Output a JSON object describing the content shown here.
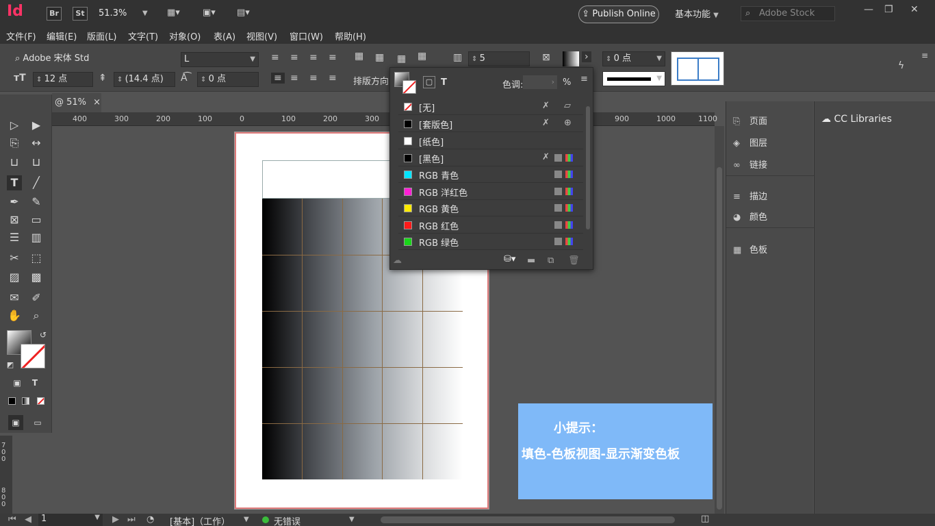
{
  "titlebar": {
    "app_logo": "Id",
    "bridge_label": "Br",
    "stock_label": "St",
    "zoom": "51.3%",
    "publish_label": "Publish Online",
    "workspace": "基本功能",
    "stock_placeholder": "Adobe Stock",
    "win_minimize": "—",
    "win_restore": "❐",
    "win_close": "✕"
  },
  "menu": [
    "文件(F)",
    "编辑(E)",
    "版面(L)",
    "文字(T)",
    "对象(O)",
    "表(A)",
    "视图(V)",
    "窗口(W)",
    "帮助(H)"
  ],
  "control": {
    "font_family": "Adobe 宋体 Std",
    "font_style": "L",
    "font_size": "12 点",
    "leading": "(14.4 点)",
    "tracking": "0 点",
    "columns": "5",
    "stroke_weight": "0 点",
    "direction_label": "排版方向"
  },
  "doc_tab": {
    "label": "@ 51%",
    "close": "×"
  },
  "ruler_ticks": [
    "400",
    "300",
    "200",
    "100",
    "0",
    "100",
    "200",
    "300",
    "900",
    "1000",
    "1100"
  ],
  "vruler_ticks": [
    "700",
    "800"
  ],
  "swatches": {
    "tint_label": "色调:",
    "tint_unit": "%",
    "items": [
      {
        "name": "[无]",
        "color": "#ffffff"
      },
      {
        "name": "[套版色]",
        "color": "#000000"
      },
      {
        "name": "[纸色]",
        "color": "#ffffff"
      },
      {
        "name": "[黑色]",
        "color": "#000000"
      },
      {
        "name": "RGB 青色",
        "color": "#00e5ff"
      },
      {
        "name": "RGB 洋红色",
        "color": "#ff1fd5"
      },
      {
        "name": "RGB 黄色",
        "color": "#ffea00"
      },
      {
        "name": "RGB 红色",
        "color": "#ff1a1a"
      },
      {
        "name": "RGB 绿色",
        "color": "#1ad61a"
      }
    ]
  },
  "dock": {
    "pages": "页面",
    "layers": "图层",
    "links": "链接",
    "stroke": "描边",
    "color": "颜色",
    "swatches": "色板",
    "cc_libraries": "CC Libraries"
  },
  "tip": {
    "title": "小提示：",
    "body": "填色-色板视图-显示渐变色板"
  },
  "status": {
    "page": "1",
    "master": "[基本]（工作）",
    "errors": "无错误"
  }
}
